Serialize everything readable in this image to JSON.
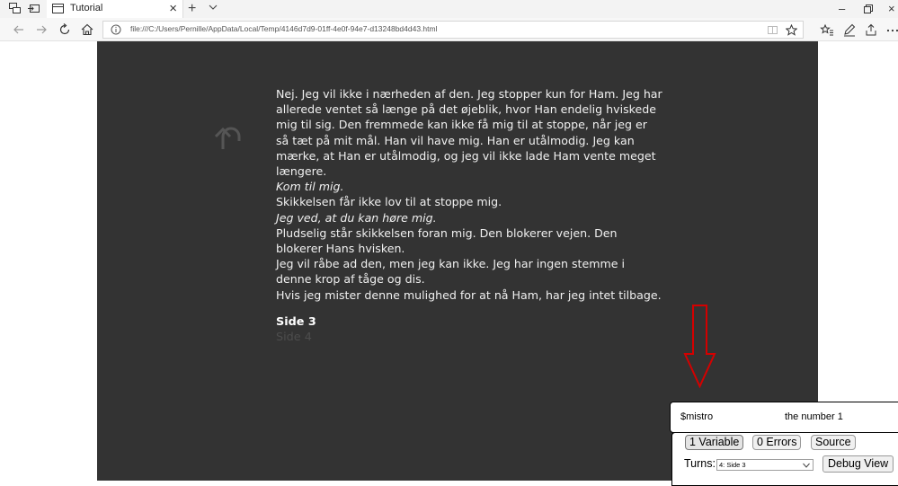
{
  "browser": {
    "tab_title": "Tutorial",
    "tab_close": "×",
    "new_tab": "+",
    "address": "file:///C:/Users/Pernille/AppData/Local/Temp/4146d7d9-01ff-4e0f-94e7-d13248bd4d43.html",
    "window_minimize": "–",
    "window_close": "×"
  },
  "story": {
    "paragraphs": [
      {
        "text": "Nej. Jeg vil ikke i nærheden af den. Jeg stopper kun for Ham. Jeg har allerede ventet så længe på det øjeblik, hvor Han endelig hviskede mig til sig. Den fremmede kan ikke få mig til at stoppe, når jeg er så tæt på mit mål. Han vil have mig. Han er utålmodig. Jeg kan mærke, at Han er utålmodig, og jeg vil ikke lade Ham vente meget længere."
      },
      {
        "text": "Kom til mig."
      },
      {
        "text": "Skikkelsen får ikke lov til at stoppe mig."
      },
      {
        "text": "Jeg ved, at du kan høre mig."
      },
      {
        "text": "Pludselig står skikkelsen foran mig. Den blokerer vejen. Den blokerer Hans hvisken."
      },
      {
        "text": "Jeg vil råbe ad den, men jeg kan ikke. Jeg har ingen stemme i denne krop af tåge og dis."
      },
      {
        "text": "Hvis jeg mister denne mulighed for at nå Ham, har jeg intet tilbage."
      }
    ],
    "links": [
      "Side 3",
      "Side 4"
    ]
  },
  "debug": {
    "variable_name": "$mistro",
    "variable_value": "the number 1",
    "variables_button": "1 Variable",
    "errors_button": "0 Errors",
    "source_button": "Source",
    "turns_label": "Turns:",
    "turns_selected": "4: Side 3",
    "debug_view_button": "Debug View"
  },
  "colors": {
    "story_bg": "#333333",
    "story_text": "#f0f0f0",
    "link_dim": "#4d4d4d",
    "annotation_arrow": "#d40000"
  }
}
